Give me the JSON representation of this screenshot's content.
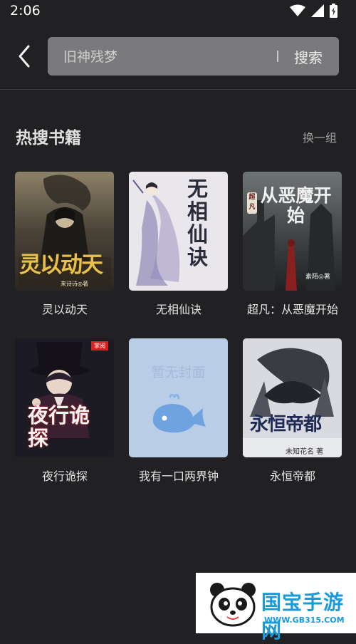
{
  "status_bar": {
    "time": "2:06"
  },
  "search": {
    "placeholder": "旧神残梦",
    "button_label": "搜索"
  },
  "hot_section": {
    "title": "热搜书籍",
    "refresh_label": "换一组"
  },
  "books": [
    {
      "title": "灵以动天",
      "cover_text": "灵以动天",
      "author_caption": "来诗诗◎著"
    },
    {
      "title": "无相仙诀",
      "cover_text": "无相仙诀"
    },
    {
      "title": "超凡：从恶魔开始",
      "cover_text": "从恶魔开始",
      "cover_badge": "超凡",
      "author_caption": "素陌◎著"
    },
    {
      "title": "夜行诡探",
      "cover_text": "夜行诡探",
      "cover_badge": "掌阅"
    },
    {
      "title": "我有一口两界钟",
      "cover_text": "暂无封面"
    },
    {
      "title": "永恒帝都",
      "cover_text": "永恒帝都",
      "author_caption": "未知花名 著"
    }
  ],
  "watermark": {
    "brand": "国宝手游网",
    "url": "WWW.GB315.COM"
  }
}
